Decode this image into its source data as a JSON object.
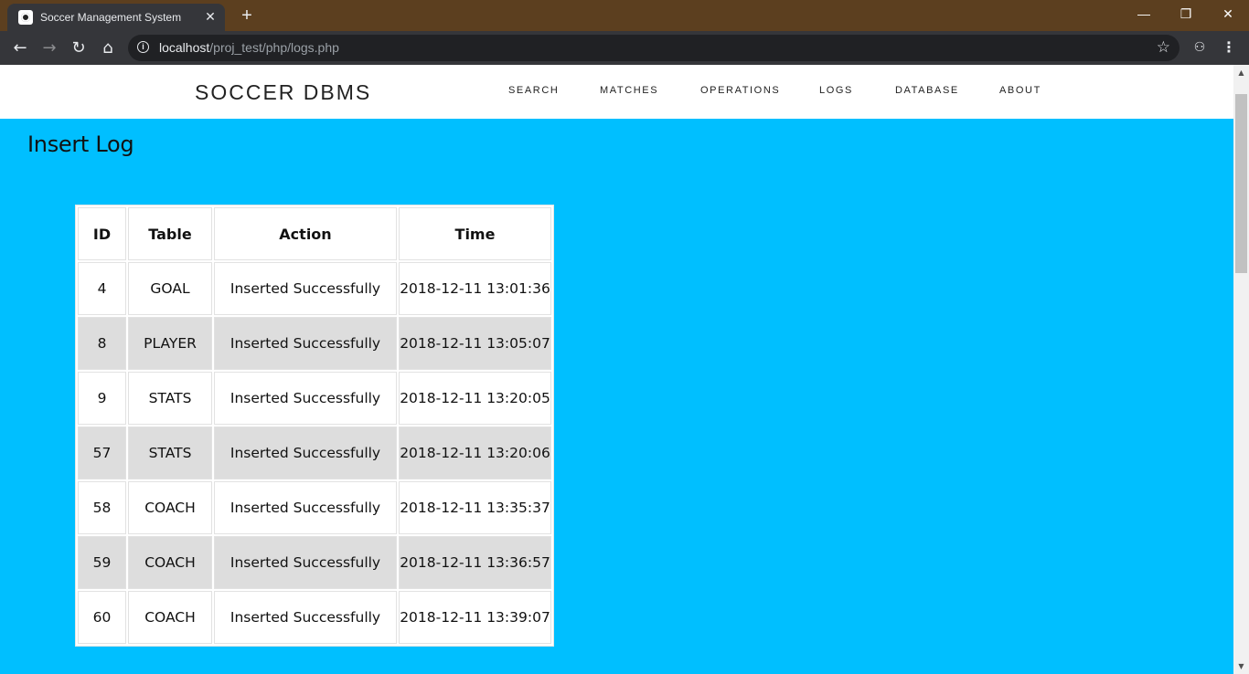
{
  "browser": {
    "tab_title": "Soccer Management System",
    "tab_close": "✕",
    "new_tab": "+",
    "url_host": "localhost",
    "url_path": "/proj_test/php/logs.php",
    "window_controls": [
      "—",
      "❐",
      "✕"
    ]
  },
  "site": {
    "brand": "SOCCER DBMS",
    "nav": [
      "SEARCH",
      "MATCHES",
      "OPERATIONS",
      "LOGS",
      "DATABASE",
      "ABOUT"
    ]
  },
  "main": {
    "title": "Insert Log",
    "table": {
      "headers": [
        "ID",
        "Table",
        "Action",
        "Time"
      ],
      "rows": [
        [
          "4",
          "GOAL",
          "Inserted Successfully",
          "2018-12-11 13:01:36"
        ],
        [
          "8",
          "PLAYER",
          "Inserted Successfully",
          "2018-12-11 13:05:07"
        ],
        [
          "9",
          "STATS",
          "Inserted Successfully",
          "2018-12-11 13:20:05"
        ],
        [
          "57",
          "STATS",
          "Inserted Successfully",
          "2018-12-11 13:20:06"
        ],
        [
          "58",
          "COACH",
          "Inserted Successfully",
          "2018-12-11 13:35:37"
        ],
        [
          "59",
          "COACH",
          "Inserted Successfully",
          "2018-12-11 13:36:57"
        ],
        [
          "60",
          "COACH",
          "Inserted Successfully",
          "2018-12-11 13:39:07"
        ]
      ]
    }
  },
  "colors": {
    "page_background": "#00bfff",
    "alt_row": "#dddddd",
    "title_bar": "#5c3f1f"
  }
}
